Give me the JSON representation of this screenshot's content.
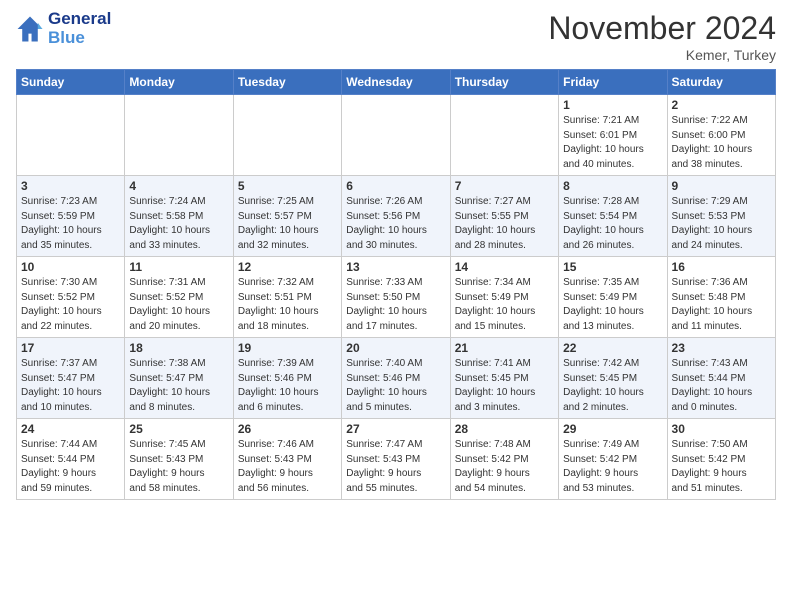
{
  "header": {
    "logo_line1": "General",
    "logo_line2": "Blue",
    "month": "November 2024",
    "location": "Kemer, Turkey"
  },
  "days_of_week": [
    "Sunday",
    "Monday",
    "Tuesday",
    "Wednesday",
    "Thursday",
    "Friday",
    "Saturday"
  ],
  "weeks": [
    [
      {
        "day": "",
        "info": ""
      },
      {
        "day": "",
        "info": ""
      },
      {
        "day": "",
        "info": ""
      },
      {
        "day": "",
        "info": ""
      },
      {
        "day": "",
        "info": ""
      },
      {
        "day": "1",
        "info": "Sunrise: 7:21 AM\nSunset: 6:01 PM\nDaylight: 10 hours\nand 40 minutes."
      },
      {
        "day": "2",
        "info": "Sunrise: 7:22 AM\nSunset: 6:00 PM\nDaylight: 10 hours\nand 38 minutes."
      }
    ],
    [
      {
        "day": "3",
        "info": "Sunrise: 7:23 AM\nSunset: 5:59 PM\nDaylight: 10 hours\nand 35 minutes."
      },
      {
        "day": "4",
        "info": "Sunrise: 7:24 AM\nSunset: 5:58 PM\nDaylight: 10 hours\nand 33 minutes."
      },
      {
        "day": "5",
        "info": "Sunrise: 7:25 AM\nSunset: 5:57 PM\nDaylight: 10 hours\nand 32 minutes."
      },
      {
        "day": "6",
        "info": "Sunrise: 7:26 AM\nSunset: 5:56 PM\nDaylight: 10 hours\nand 30 minutes."
      },
      {
        "day": "7",
        "info": "Sunrise: 7:27 AM\nSunset: 5:55 PM\nDaylight: 10 hours\nand 28 minutes."
      },
      {
        "day": "8",
        "info": "Sunrise: 7:28 AM\nSunset: 5:54 PM\nDaylight: 10 hours\nand 26 minutes."
      },
      {
        "day": "9",
        "info": "Sunrise: 7:29 AM\nSunset: 5:53 PM\nDaylight: 10 hours\nand 24 minutes."
      }
    ],
    [
      {
        "day": "10",
        "info": "Sunrise: 7:30 AM\nSunset: 5:52 PM\nDaylight: 10 hours\nand 22 minutes."
      },
      {
        "day": "11",
        "info": "Sunrise: 7:31 AM\nSunset: 5:52 PM\nDaylight: 10 hours\nand 20 minutes."
      },
      {
        "day": "12",
        "info": "Sunrise: 7:32 AM\nSunset: 5:51 PM\nDaylight: 10 hours\nand 18 minutes."
      },
      {
        "day": "13",
        "info": "Sunrise: 7:33 AM\nSunset: 5:50 PM\nDaylight: 10 hours\nand 17 minutes."
      },
      {
        "day": "14",
        "info": "Sunrise: 7:34 AM\nSunset: 5:49 PM\nDaylight: 10 hours\nand 15 minutes."
      },
      {
        "day": "15",
        "info": "Sunrise: 7:35 AM\nSunset: 5:49 PM\nDaylight: 10 hours\nand 13 minutes."
      },
      {
        "day": "16",
        "info": "Sunrise: 7:36 AM\nSunset: 5:48 PM\nDaylight: 10 hours\nand 11 minutes."
      }
    ],
    [
      {
        "day": "17",
        "info": "Sunrise: 7:37 AM\nSunset: 5:47 PM\nDaylight: 10 hours\nand 10 minutes."
      },
      {
        "day": "18",
        "info": "Sunrise: 7:38 AM\nSunset: 5:47 PM\nDaylight: 10 hours\nand 8 minutes."
      },
      {
        "day": "19",
        "info": "Sunrise: 7:39 AM\nSunset: 5:46 PM\nDaylight: 10 hours\nand 6 minutes."
      },
      {
        "day": "20",
        "info": "Sunrise: 7:40 AM\nSunset: 5:46 PM\nDaylight: 10 hours\nand 5 minutes."
      },
      {
        "day": "21",
        "info": "Sunrise: 7:41 AM\nSunset: 5:45 PM\nDaylight: 10 hours\nand 3 minutes."
      },
      {
        "day": "22",
        "info": "Sunrise: 7:42 AM\nSunset: 5:45 PM\nDaylight: 10 hours\nand 2 minutes."
      },
      {
        "day": "23",
        "info": "Sunrise: 7:43 AM\nSunset: 5:44 PM\nDaylight: 10 hours\nand 0 minutes."
      }
    ],
    [
      {
        "day": "24",
        "info": "Sunrise: 7:44 AM\nSunset: 5:44 PM\nDaylight: 9 hours\nand 59 minutes."
      },
      {
        "day": "25",
        "info": "Sunrise: 7:45 AM\nSunset: 5:43 PM\nDaylight: 9 hours\nand 58 minutes."
      },
      {
        "day": "26",
        "info": "Sunrise: 7:46 AM\nSunset: 5:43 PM\nDaylight: 9 hours\nand 56 minutes."
      },
      {
        "day": "27",
        "info": "Sunrise: 7:47 AM\nSunset: 5:43 PM\nDaylight: 9 hours\nand 55 minutes."
      },
      {
        "day": "28",
        "info": "Sunrise: 7:48 AM\nSunset: 5:42 PM\nDaylight: 9 hours\nand 54 minutes."
      },
      {
        "day": "29",
        "info": "Sunrise: 7:49 AM\nSunset: 5:42 PM\nDaylight: 9 hours\nand 53 minutes."
      },
      {
        "day": "30",
        "info": "Sunrise: 7:50 AM\nSunset: 5:42 PM\nDaylight: 9 hours\nand 51 minutes."
      }
    ]
  ]
}
